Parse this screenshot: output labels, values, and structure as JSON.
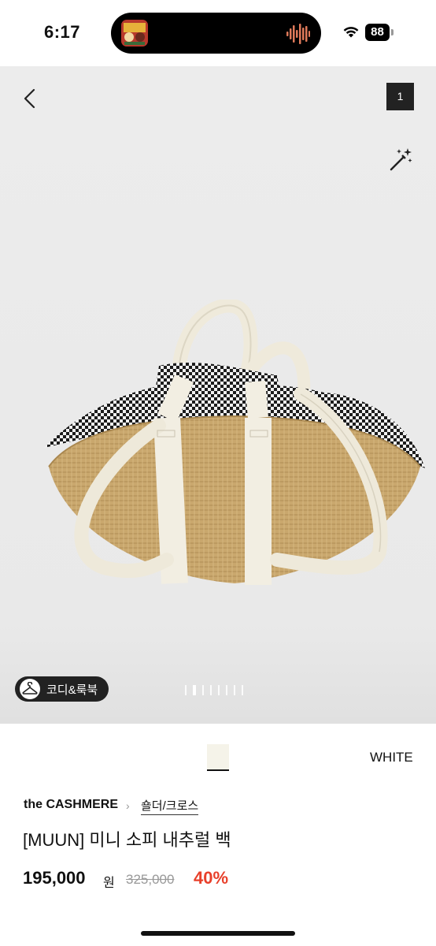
{
  "status": {
    "time": "6:17",
    "battery": "88",
    "icons": [
      "album-art-icon",
      "waveform-icon",
      "wifi-icon",
      "battery-icon"
    ]
  },
  "gallery": {
    "page_number": "1",
    "coordi_label": "코디&룩북",
    "slide_count": 8,
    "active_slide": 2,
    "icons": [
      "back-chevron-icon",
      "magic-wand-icon",
      "hanger-icon"
    ]
  },
  "product": {
    "color_name": "WHITE",
    "swatch_color": "#f5f3e9",
    "brand": "the CASHMERE",
    "category": "숄더/크로스",
    "title": "[MUUN] 미니 소피 내추럴 백",
    "price": "195,000",
    "currency": "원",
    "original_price": "325,000",
    "discount": "40%",
    "discount_color": "#e8402b"
  }
}
